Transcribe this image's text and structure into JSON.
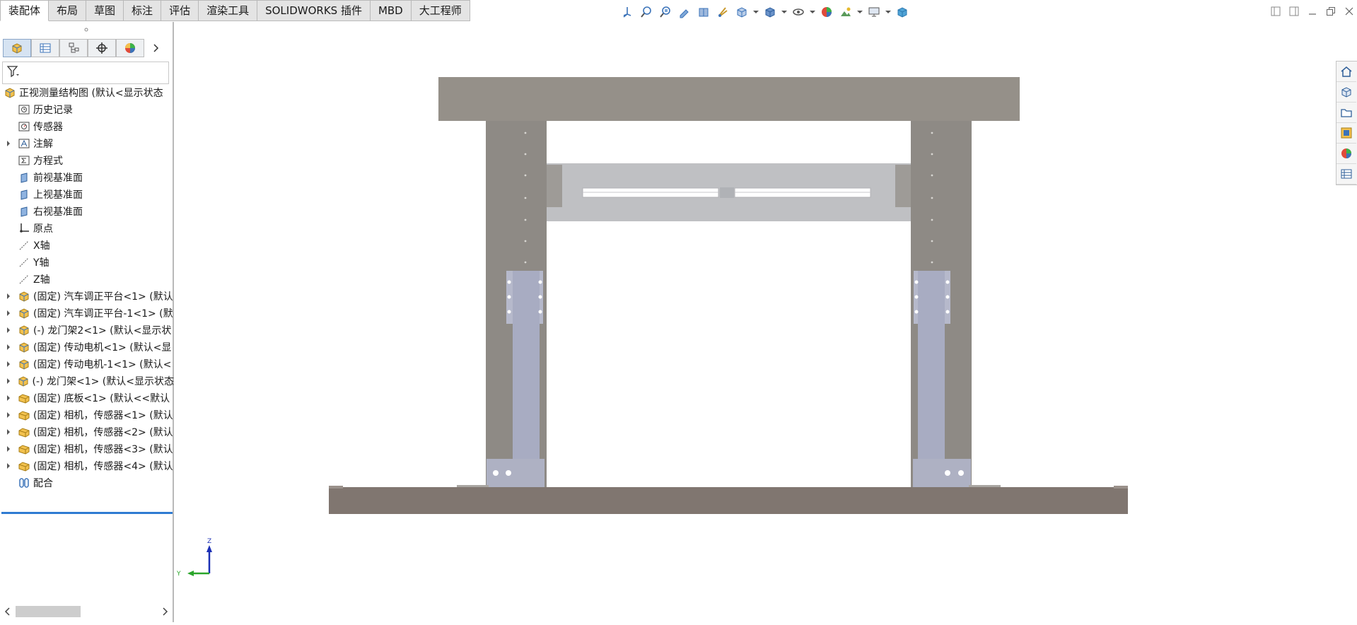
{
  "command_tabs": [
    "装配体",
    "布局",
    "草图",
    "标注",
    "评估",
    "渲染工具",
    "SOLIDWORKS 插件",
    "MBD",
    "大工程师"
  ],
  "active_tab": "装配体",
  "hud_toolbar": [
    "view-orientation-icon",
    "zoom-to-fit-icon",
    "zoom-to-area-icon",
    "previous-view-icon",
    "section-view-icon",
    "dynamic-annotation-icon",
    "view-orientation-box-icon",
    "display-style-icon",
    "hide-show-items-icon",
    "edit-appearance-icon",
    "apply-scene-icon",
    "view-settings-icon",
    "3d-view-icon"
  ],
  "feature_tree": {
    "root": "正视测量结构图  (默认<显示状态",
    "nodes": [
      {
        "label": "历史记录",
        "icon": "history-icon"
      },
      {
        "label": "传感器",
        "icon": "sensor-icon"
      },
      {
        "label": "注解",
        "icon": "annotation-icon",
        "expandable": true
      },
      {
        "label": "方程式",
        "icon": "equation-icon"
      },
      {
        "label": "前视基准面",
        "icon": "plane-icon"
      },
      {
        "label": "上视基准面",
        "icon": "plane-icon"
      },
      {
        "label": "右视基准面",
        "icon": "plane-icon"
      },
      {
        "label": "原点",
        "icon": "origin-icon"
      },
      {
        "label": "X轴",
        "icon": "axis-icon"
      },
      {
        "label": "Y轴",
        "icon": "axis-icon"
      },
      {
        "label": "Z轴",
        "icon": "axis-icon"
      }
    ],
    "components": [
      {
        "label": "(固定) 汽车调正平台<1> (默认",
        "icon": "subassembly-icon"
      },
      {
        "label": "(固定) 汽车调正平台-1<1> (默",
        "icon": "subassembly-icon"
      },
      {
        "label": "(-) 龙门架2<1> (默认<显示状",
        "icon": "subassembly-icon"
      },
      {
        "label": "(固定) 传动电机<1> (默认<显",
        "icon": "subassembly-icon"
      },
      {
        "label": "(固定) 传动电机-1<1> (默认<",
        "icon": "subassembly-icon"
      },
      {
        "label": "(-) 龙门架<1> (默认<显示状态",
        "icon": "subassembly-icon"
      },
      {
        "label": "(固定) 底板<1> (默认<<默认",
        "icon": "part-icon"
      },
      {
        "label": "(固定) 相机，传感器<1> (默认",
        "icon": "part-icon"
      },
      {
        "label": "(固定) 相机，传感器<2> (默认",
        "icon": "part-icon"
      },
      {
        "label": "(固定) 相机，传感器<3> (默认",
        "icon": "part-icon"
      },
      {
        "label": "(固定) 相机，传感器<4> (默认",
        "icon": "part-icon"
      }
    ],
    "mates": "配合"
  },
  "triad": {
    "z": "Z",
    "y": "Y"
  },
  "colors": {
    "gantry_top": "#959089",
    "gantry_leg": "#8e8a85",
    "base_plate": "#807670",
    "crossbar": "#bfc0c3",
    "stand": "#a8acc2",
    "selection": "#2f7bd2"
  }
}
